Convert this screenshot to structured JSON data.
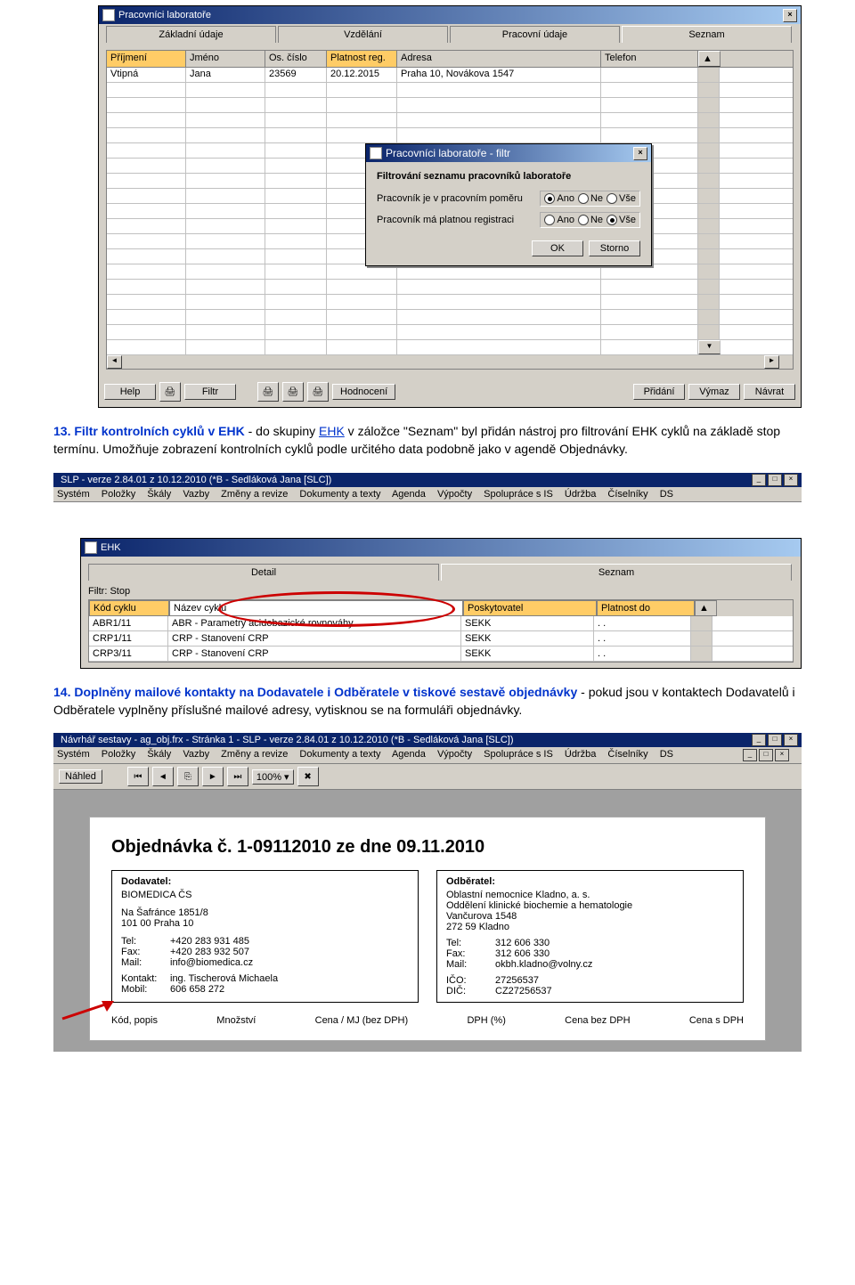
{
  "win1": {
    "title": "Pracovníci laboratoře",
    "tabs": [
      "Základní údaje",
      "Vzdělání",
      "Pracovní údaje",
      "Seznam"
    ],
    "cols": [
      "Příjmení",
      "Jméno",
      "Os. číslo",
      "Platnost reg.",
      "Adresa",
      "Telefon"
    ],
    "row": {
      "prijmeni": "Vtipná",
      "jmeno": "Jana",
      "cislo": "23569",
      "platnost": "20.12.2015",
      "adresa": "Praha 10, Novákova 1547",
      "tel": ""
    },
    "buttons": {
      "help": "Help",
      "filtr": "Filtr",
      "hodnoceni": "Hodnocení",
      "pridani": "Přidání",
      "vymaz": "Výmaz",
      "navrat": "Návrat"
    }
  },
  "dlg": {
    "title": "Pracovníci laboratoře - filtr",
    "heading": "Filtrování seznamu pracovníků laboratoře",
    "row1_label": "Pracovník je v pracovním poměru",
    "row2_label": "Pracovník má platnou registraci",
    "opts": {
      "ano": "Ano",
      "ne": "Ne",
      "vse": "Vše"
    },
    "ok": "OK",
    "storno": "Storno"
  },
  "para13": {
    "num": "13. ",
    "title": "Filtr kontrolních cyklů v EHK",
    "text1": " - do skupiny ",
    "link": "EHK",
    "text2": " v záložce \"Seznam\" byl přidán nástroj pro filtrování EHK cyklů na základě stop termínu. Umožňuje zobrazení kontrolních cyklů podle určitého data podobně jako v agendě Objednávky."
  },
  "slp_title": "SLP - verze 2.84.01 z 10.12.2010 (*B - Sedláková Jana [SLC])",
  "slp_menu": [
    "Systém",
    "Položky",
    "Škály",
    "Vazby",
    "Změny a revize",
    "Dokumenty a texty",
    "Agenda",
    "Výpočty",
    "Spolupráce s IS",
    "Údržba",
    "Číselníky",
    "DS"
  ],
  "ehk": {
    "title": "EHK",
    "tabs": {
      "detail": "Detail",
      "seznam": "Seznam"
    },
    "filtr_label": "Filtr:  Stop",
    "cols": [
      "Kód cyklu",
      "Název cyklu",
      "Poskytovatel",
      "Platnost do"
    ],
    "rows": [
      {
        "kod": "ABR1/11",
        "nazev": "ABR - Parametry acidobazické rovnováhy",
        "posk": "SEKK",
        "plat": ".  ."
      },
      {
        "kod": "CRP1/11",
        "nazev": "CRP - Stanovení CRP",
        "posk": "SEKK",
        "plat": ".  ."
      },
      {
        "kod": "CRP3/11",
        "nazev": "CRP - Stanovení CRP",
        "posk": "SEKK",
        "plat": ".  ."
      }
    ]
  },
  "para14": {
    "num": "14. ",
    "title": "Doplněny mailové kontakty na Dodavatele i Odběratele v tiskové sestavě objednávky",
    "text": " - pokud jsou v kontaktech Dodavatelů i Odběratele vyplněny příslušné mailové adresy, vytisknou se na formuláři objednávky."
  },
  "designer_title": "Návrhář sestavy - ag_obj.frx - Stránka 1 - SLP - verze 2.84.01 z 10.12.2010 (*B - Sedláková Jana [SLC])",
  "nahled": "Náhled",
  "zoom": "100%",
  "report": {
    "title": "Objednávka č. 1-09112010  ze dne 09.11.2010",
    "dodavatel_h": "Dodavatel:",
    "dod": {
      "name": "BIOMEDICA ČS",
      "addr1": "Na Šafránce 1851/8",
      "addr2": "101 00 Praha 10",
      "tel_l": "Tel:",
      "tel": "+420 283 931 485",
      "fax_l": "Fax:",
      "fax": "+420 283 932 507",
      "mail_l": "Mail:",
      "mail": "info@biomedica.cz",
      "kontakt_l": "Kontakt:",
      "kontakt": "ing. Tischerová Michaela",
      "mobil_l": "Mobil:",
      "mobil": "606 658 272"
    },
    "odberatel_h": "Odběratel:",
    "odb": {
      "name": "Oblastní nemocnice Kladno, a. s.",
      "dept": "Oddělení klinické biochemie a hematologie",
      "addr1": "Vančurova 1548",
      "addr2": "272 59 Kladno",
      "tel_l": "Tel:",
      "tel": "312 606 330",
      "fax_l": "Fax:",
      "fax": "312 606 330",
      "mail_l": "Mail:",
      "mail": "okbh.kladno@volny.cz",
      "ico_l": "IČO:",
      "ico": "27256537",
      "dic_l": "DIČ:",
      "dic": "CZ27256537"
    },
    "cols": [
      "Kód, popis",
      "Množství",
      "Cena / MJ (bez DPH)",
      "DPH (%)",
      "Cena bez DPH",
      "Cena s DPH"
    ]
  }
}
